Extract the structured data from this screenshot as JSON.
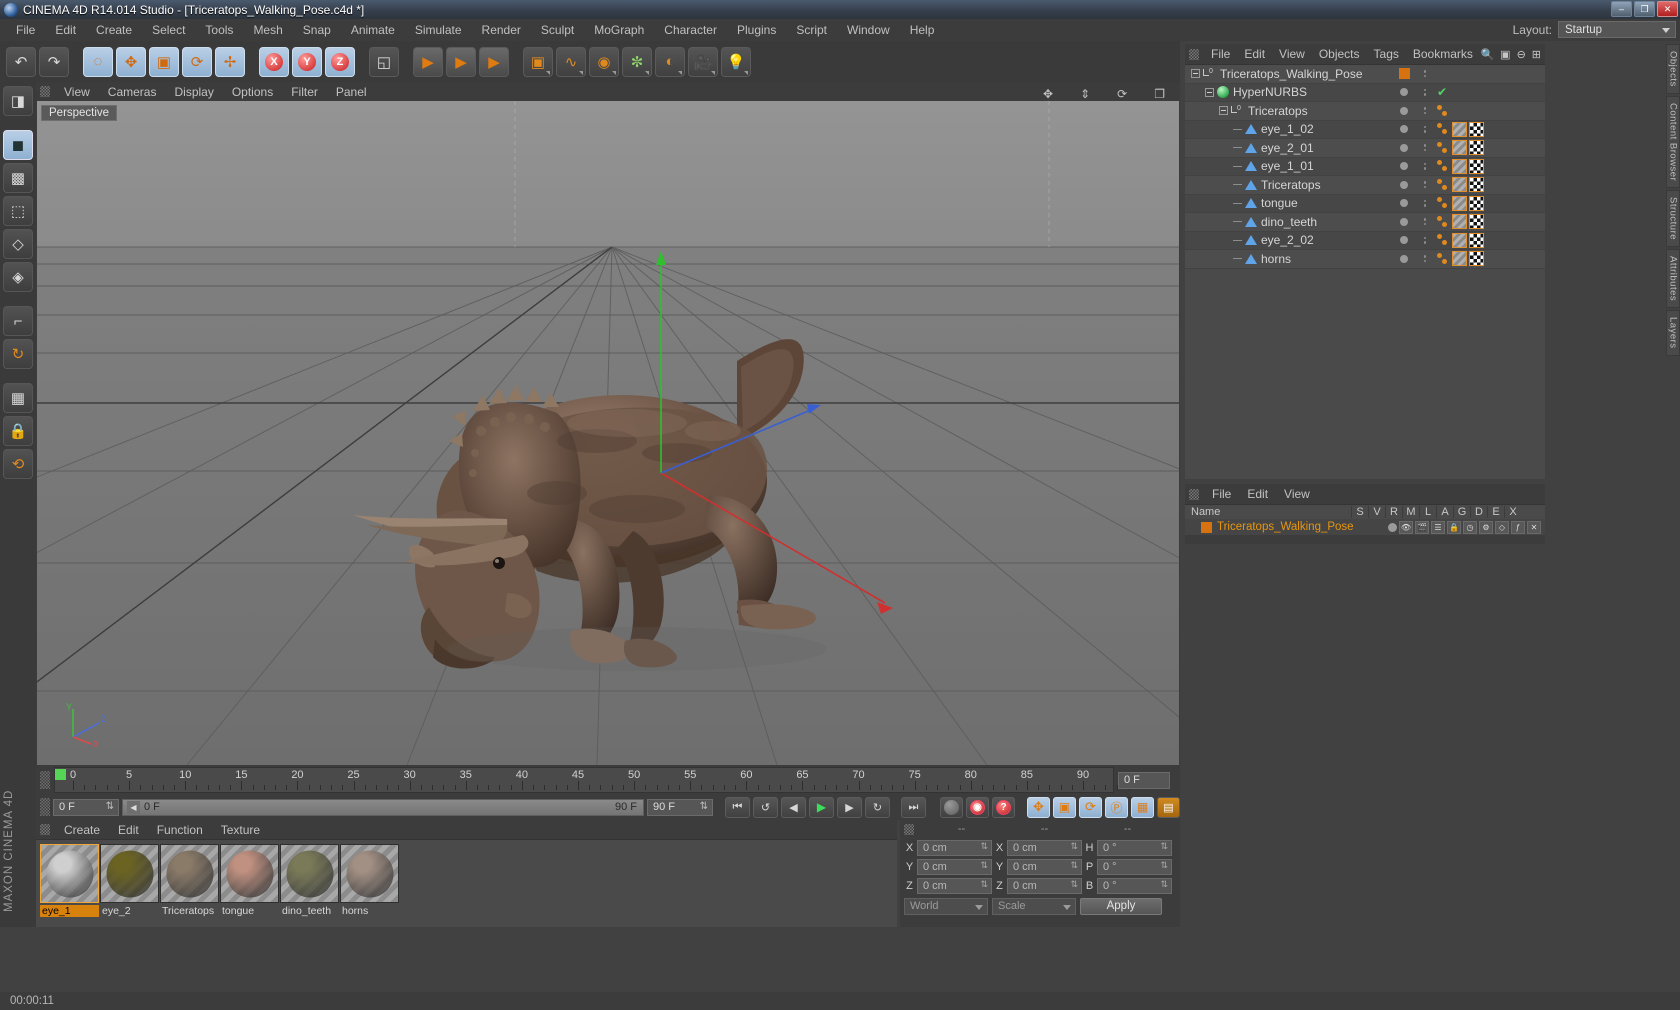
{
  "window": {
    "title": "CINEMA 4D R14.014 Studio - [Triceratops_Walking_Pose.c4d *]",
    "minimize": "–",
    "maximize": "❐",
    "close": "✕"
  },
  "menubar": {
    "items": [
      "File",
      "Edit",
      "Create",
      "Select",
      "Tools",
      "Mesh",
      "Snap",
      "Animate",
      "Simulate",
      "Render",
      "Sculpt",
      "MoGraph",
      "Character",
      "Plugins",
      "Script",
      "Window",
      "Help"
    ]
  },
  "layout": {
    "label": "Layout:",
    "value": "Startup"
  },
  "toolbar": {
    "buttons": [
      {
        "name": "undo-button",
        "glyph": "↶"
      },
      {
        "name": "redo-button",
        "glyph": "↷"
      },
      {
        "name": "live-selection-tool",
        "glyph": "◌"
      },
      {
        "name": "move-tool",
        "glyph": "✥"
      },
      {
        "name": "scale-tool",
        "glyph": "▣"
      },
      {
        "name": "rotate-tool",
        "glyph": "⟳"
      },
      {
        "name": "move-scale-rotate-tool",
        "glyph": "✢"
      },
      {
        "name": "x-axis-lock",
        "glyph": "X"
      },
      {
        "name": "y-axis-lock",
        "glyph": "Y"
      },
      {
        "name": "z-axis-lock",
        "glyph": "Z"
      },
      {
        "name": "world-object-coordinates",
        "glyph": "◱"
      },
      {
        "name": "render-view-button",
        "glyph": "▶"
      },
      {
        "name": "render-region-button",
        "glyph": "▶"
      },
      {
        "name": "render-settings-button",
        "glyph": "▶"
      },
      {
        "name": "add-cube-button",
        "glyph": "▣"
      },
      {
        "name": "add-spline-button",
        "glyph": "∿"
      },
      {
        "name": "add-nurbs-button",
        "glyph": "◉"
      },
      {
        "name": "add-array-button",
        "glyph": "✼"
      },
      {
        "name": "add-scene-object-button",
        "glyph": "◐"
      },
      {
        "name": "add-camera-button",
        "glyph": "🎥"
      },
      {
        "name": "add-light-button",
        "glyph": "💡"
      }
    ]
  },
  "lefttools": {
    "buttons": [
      {
        "name": "make-editable-tool",
        "glyph": "◨"
      },
      {
        "name": "model-mode-tool",
        "glyph": "◼"
      },
      {
        "name": "texture-mode-tool",
        "glyph": "▩"
      },
      {
        "name": "points-mode-tool",
        "glyph": "⬚"
      },
      {
        "name": "edges-mode-tool",
        "glyph": "◇"
      },
      {
        "name": "polygons-mode-tool",
        "glyph": "◈"
      },
      {
        "name": "axis-mode-tool",
        "glyph": "⌐"
      },
      {
        "name": "enable-axis-tool",
        "glyph": "↻"
      },
      {
        "name": "viewport-solo-tool",
        "glyph": "▦"
      },
      {
        "name": "lock-workplane-tool",
        "glyph": "🔒"
      },
      {
        "name": "workplane-tool",
        "glyph": "⟲"
      }
    ],
    "brand": "MAXON CINEMA 4D"
  },
  "viewport": {
    "menus": [
      "View",
      "Cameras",
      "Display",
      "Options",
      "Filter",
      "Panel"
    ],
    "label": "Perspective",
    "axis": {
      "x": "X",
      "y": "Y",
      "z": "Z"
    },
    "corner_icons": [
      "pan-icon",
      "dolly-icon",
      "rotate-icon",
      "maximize-icon"
    ]
  },
  "timeline": {
    "ticks": [
      0,
      5,
      10,
      15,
      20,
      25,
      30,
      35,
      40,
      45,
      50,
      55,
      60,
      65,
      70,
      75,
      80,
      85,
      90
    ],
    "current_frame_field": "0 F",
    "current_frame_marker": "0 F",
    "track_start": "0 F",
    "track_end": "90 F",
    "preview_end": "90 F",
    "transport": [
      {
        "name": "go-to-start-button",
        "glyph": "⏮"
      },
      {
        "name": "play-backwards-button",
        "glyph": "↺"
      },
      {
        "name": "previous-frame-button",
        "glyph": "◀"
      },
      {
        "name": "play-forwards-button",
        "glyph": "▶"
      },
      {
        "name": "next-frame-button",
        "glyph": "▶"
      },
      {
        "name": "play-loop-button",
        "glyph": "↻"
      },
      {
        "name": "go-to-end-button",
        "glyph": "⏭"
      }
    ],
    "record_buttons": [
      {
        "name": "record-active-objects-button",
        "glyph": "⊘"
      },
      {
        "name": "autokeying-button",
        "glyph": "◉"
      },
      {
        "name": "keyframe-selection-button",
        "glyph": "?"
      }
    ],
    "key_toggles": [
      {
        "name": "position-key-toggle",
        "glyph": "✥"
      },
      {
        "name": "scale-key-toggle",
        "glyph": "▣"
      },
      {
        "name": "rotation-key-toggle",
        "glyph": "⟳"
      },
      {
        "name": "parameter-key-toggle",
        "glyph": "Ⓟ"
      },
      {
        "name": "pla-key-toggle",
        "glyph": "▦"
      },
      {
        "name": "animation-mode-toggle",
        "glyph": "▤"
      }
    ]
  },
  "materials": {
    "menus": [
      "Create",
      "Edit",
      "Function",
      "Texture"
    ],
    "items": [
      {
        "name": "eye_1",
        "color": "#cfcfcf",
        "selected": true
      },
      {
        "name": "eye_2",
        "color": "#6b6322",
        "selected": false
      },
      {
        "name": "Triceratops",
        "color": "#8a7a68",
        "selected": false
      },
      {
        "name": "tongue",
        "color": "#c09080",
        "selected": false
      },
      {
        "name": "dino_teeth",
        "color": "#7a7a58",
        "selected": false
      },
      {
        "name": "horns",
        "color": "#a39084",
        "selected": false
      }
    ]
  },
  "coordinates": {
    "headers": [
      "--",
      "--",
      "--"
    ],
    "rows": [
      {
        "axis1": "X",
        "pos": "0 cm",
        "axis2": "X",
        "size": "0 cm",
        "axis3": "H",
        "rot": "0 °"
      },
      {
        "axis1": "Y",
        "pos": "0 cm",
        "axis2": "Y",
        "size": "0 cm",
        "axis3": "P",
        "rot": "0 °"
      },
      {
        "axis1": "Z",
        "pos": "0 cm",
        "axis2": "Z",
        "size": "0 cm",
        "axis3": "B",
        "rot": "0 °"
      }
    ],
    "system": "World",
    "mode": "Scale",
    "apply": "Apply"
  },
  "object_manager": {
    "menus": [
      "File",
      "Edit",
      "View",
      "Objects",
      "Tags",
      "Bookmarks"
    ],
    "right_icons": [
      "search-icon",
      "find-icon",
      "minus-icon",
      "filter-icon"
    ],
    "rows": [
      {
        "label": "Triceratops_Walking_Pose",
        "depth": 0,
        "icon": "null-object-icon",
        "expander": "open",
        "selected": true,
        "visdot": "orange-box",
        "tags": []
      },
      {
        "label": "HyperNURBS",
        "depth": 1,
        "icon": "hypernurbs-icon",
        "expander": "open",
        "selected": false,
        "visdot": "grey-dot",
        "tags": [],
        "check": "✔"
      },
      {
        "label": "Triceratops",
        "depth": 2,
        "icon": "null-object-icon",
        "expander": "open",
        "selected": false,
        "visdot": "grey-dot",
        "tags": [
          "dots"
        ]
      },
      {
        "label": "eye_1_02",
        "depth": 3,
        "icon": "polygon-object-icon",
        "expander": "none",
        "selected": false,
        "visdot": "grey-dot",
        "tags": [
          "dots",
          "mat-stripe",
          "uv"
        ]
      },
      {
        "label": "eye_2_01",
        "depth": 3,
        "icon": "polygon-object-icon",
        "expander": "none",
        "selected": false,
        "visdot": "grey-dot",
        "tags": [
          "dots",
          "mat-olive",
          "uv"
        ]
      },
      {
        "label": "eye_1_01",
        "depth": 3,
        "icon": "polygon-object-icon",
        "expander": "none",
        "selected": false,
        "visdot": "grey-dot",
        "tags": [
          "dots",
          "mat-stripe",
          "uv"
        ]
      },
      {
        "label": "Triceratops",
        "depth": 3,
        "icon": "polygon-object-icon",
        "expander": "none",
        "selected": false,
        "visdot": "grey-dot",
        "tags": [
          "dots",
          "mat-brown",
          "uv"
        ]
      },
      {
        "label": "tongue",
        "depth": 3,
        "icon": "polygon-object-icon",
        "expander": "none",
        "selected": false,
        "visdot": "grey-dot",
        "tags": [
          "dots",
          "mat-pink",
          "uv"
        ]
      },
      {
        "label": "dino_teeth",
        "depth": 3,
        "icon": "polygon-object-icon",
        "expander": "none",
        "selected": false,
        "visdot": "grey-dot",
        "tags": [
          "dots",
          "mat-dark",
          "uv"
        ]
      },
      {
        "label": "eye_2_02",
        "depth": 3,
        "icon": "polygon-object-icon",
        "expander": "none",
        "selected": false,
        "visdot": "grey-dot",
        "tags": [
          "dots",
          "mat-olive",
          "uv"
        ]
      },
      {
        "label": "horns",
        "depth": 3,
        "icon": "polygon-object-icon",
        "expander": "none",
        "selected": false,
        "visdot": "grey-dot",
        "tags": [
          "dots",
          "mat-grey",
          "uv"
        ]
      }
    ]
  },
  "layer_manager": {
    "menus": [
      "File",
      "Edit",
      "View"
    ],
    "name_header": "Name",
    "columns": [
      "S",
      "V",
      "R",
      "M",
      "L",
      "A",
      "G",
      "D",
      "E",
      "X"
    ],
    "row": {
      "label": "Triceratops_Walking_Pose"
    }
  },
  "side_tabs": [
    "Objects",
    "Content Browser",
    "Structure",
    "Attributes",
    "Layers"
  ],
  "status": {
    "text": "00:00:11"
  }
}
